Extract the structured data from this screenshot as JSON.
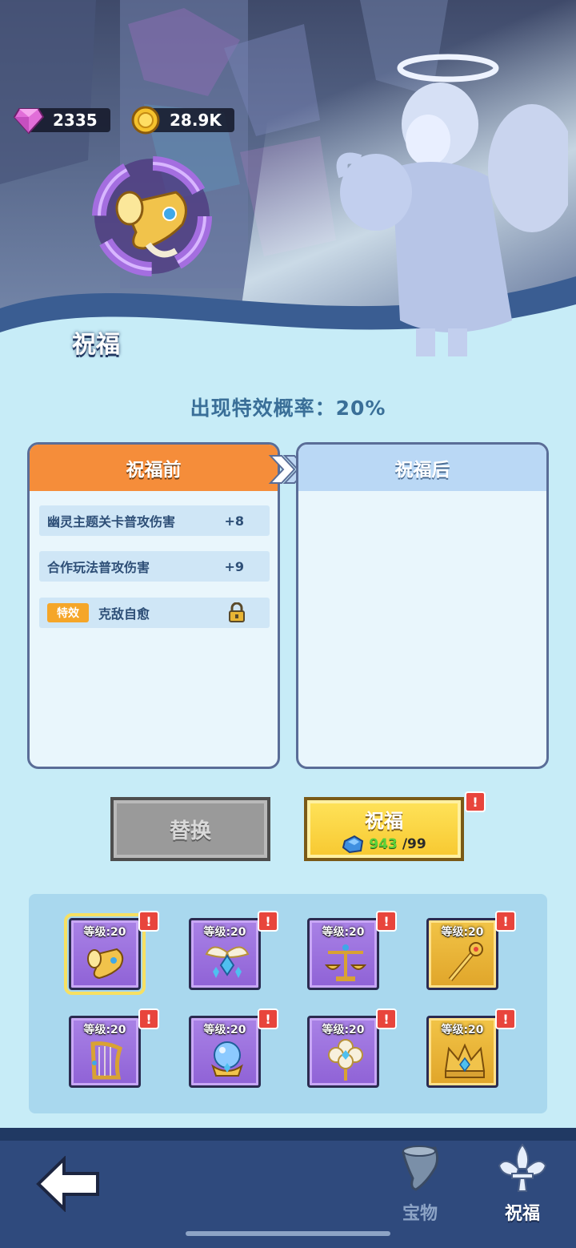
{
  "currency": {
    "gems": "2335",
    "coins": "28.9K"
  },
  "header": {
    "title": "祝福"
  },
  "probability_text": "出现特效概率：20%",
  "before_panel": {
    "title": "祝福前",
    "rows": [
      {
        "label": "幽灵主题关卡普攻伤害",
        "value": "+8"
      },
      {
        "label": "合作玩法普攻伤害",
        "value": "+9"
      }
    ],
    "special": {
      "badge": "特效",
      "label": "克敌自愈",
      "locked": true
    }
  },
  "after_panel": {
    "title": "祝福后"
  },
  "buttons": {
    "swap_label": "替换",
    "bless_label": "祝福",
    "bless_cost_have": "943",
    "bless_cost_need": "/99",
    "alert_mark": "!"
  },
  "relics": [
    {
      "level": "等级:20",
      "icon": "horn-icon",
      "rarity": "purple",
      "selected": true,
      "alert": true
    },
    {
      "level": "等级:20",
      "icon": "wings-pendant-icon",
      "rarity": "purple",
      "selected": false,
      "alert": true
    },
    {
      "level": "等级:20",
      "icon": "scales-icon",
      "rarity": "purple",
      "selected": false,
      "alert": true
    },
    {
      "level": "等级:20",
      "icon": "scepter-icon",
      "rarity": "gold",
      "selected": false,
      "alert": true
    },
    {
      "level": "等级:20",
      "icon": "harp-icon",
      "rarity": "purple",
      "selected": false,
      "alert": true
    },
    {
      "level": "等级:20",
      "icon": "crystal-ball-icon",
      "rarity": "purple",
      "selected": false,
      "alert": true
    },
    {
      "level": "等级:20",
      "icon": "flower-wand-icon",
      "rarity": "purple",
      "selected": false,
      "alert": true
    },
    {
      "level": "等级:20",
      "icon": "crown-icon",
      "rarity": "gold",
      "selected": false,
      "alert": true
    }
  ],
  "nav": {
    "treasure_label": "宝物",
    "bless_label": "祝福"
  },
  "colors": {
    "accent_orange": "#f58d3a",
    "accent_gold": "#f7c830",
    "rarity_purple": "#8f62d6",
    "rarity_gold": "#e0a52a",
    "alert_red": "#e8453c"
  }
}
